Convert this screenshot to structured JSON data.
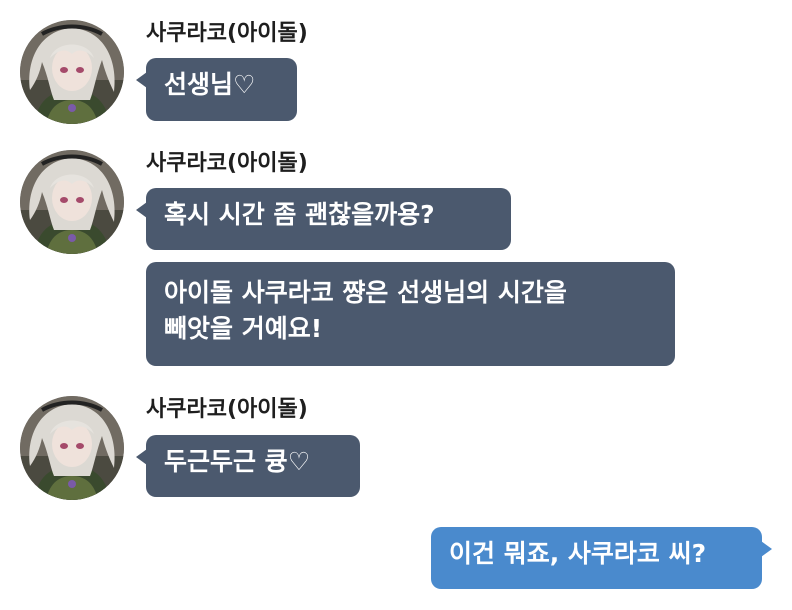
{
  "chat": {
    "groups": [
      {
        "sender": "사쿠라코(아이돌)",
        "messages": [
          "선생님♡"
        ]
      },
      {
        "sender": "사쿠라코(아이돌)",
        "messages": [
          "혹시 시간 좀 괜찮을까용?",
          "아이돌 사쿠라코 쨩은 선생님의 시간을\n빼앗을 거예요!"
        ]
      },
      {
        "sender": "사쿠라코(아이돌)",
        "messages": [
          "두근두근 큥♡"
        ]
      }
    ],
    "reply": "이건 뭐죠, 사쿠라코 씨?"
  },
  "colors": {
    "incoming_bubble": "#4b596e",
    "outgoing_bubble": "#4a8acd",
    "sender_text": "#1e1e1e"
  }
}
